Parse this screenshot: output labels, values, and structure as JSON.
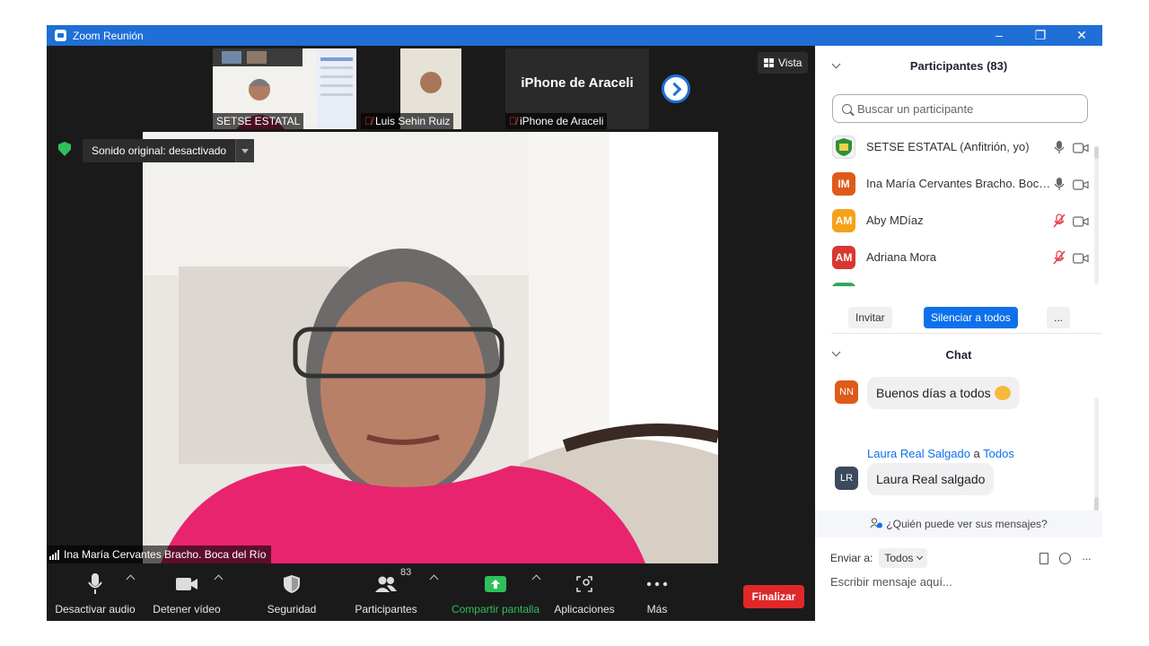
{
  "window": {
    "title": "Zoom Reunión",
    "minimize": "–",
    "restore": "❐",
    "close": "✕"
  },
  "strip": {
    "thumbs": [
      {
        "name": "SETSE ESTATAL",
        "muted": false
      },
      {
        "name": "Luis Sehin Ruiz",
        "muted": true
      },
      {
        "name": "iPhone de Araceli",
        "muted": true,
        "big_name": "iPhone de Araceli"
      }
    ],
    "view_label": "Vista"
  },
  "main_video": {
    "original_sound_label": "Sonido original: desactivado",
    "speaker_name": "Ina María Cervantes Bracho. Boca del Río"
  },
  "toolbar": {
    "audio": "Desactivar audio",
    "video": "Detener vídeo",
    "security": "Seguridad",
    "participants": "Participantes",
    "participants_count": "83",
    "share": "Compartir pantalla",
    "apps": "Aplicaciones",
    "more": "Más",
    "end": "Finalizar"
  },
  "participants_panel": {
    "title": "Participantes (83)",
    "search_placeholder": "Buscar un participante",
    "list": [
      {
        "initials": "",
        "name": "SETSE ESTATAL (Anfitrión, yo)",
        "color": "#f4f4f4",
        "mic_muted": false
      },
      {
        "initials": "IM",
        "name": "Ina María Cervantes Bracho. Boca del Río",
        "color": "#e05a1a",
        "mic_muted": false
      },
      {
        "initials": "AM",
        "name": "Aby MDíaz",
        "color": "#f5a21b",
        "mic_muted": true
      },
      {
        "initials": "AM",
        "name": "Adriana Mora",
        "color": "#d9372f",
        "mic_muted": true
      }
    ],
    "invite": "Invitar",
    "mute_all": "Silenciar a todos",
    "more": "..."
  },
  "chat": {
    "title": "Chat",
    "messages": [
      {
        "initials": "NN",
        "color": "#e05a1a",
        "text": "Buenos días a todos"
      },
      {
        "initials": "LR",
        "color": "#3c4a5e",
        "sender": "Laura Real Salgado",
        "to_word": "a",
        "to": "Todos",
        "text": "Laura Real salgado"
      }
    ],
    "who_can_see": "¿Quién puede ver sus mensajes?",
    "send_to_label": "Enviar a:",
    "send_to_value": "Todos",
    "input_placeholder": "Escribir mensaje aquí..."
  },
  "colors": {
    "accent": "#0e71eb",
    "title_bar": "#1f6fd6",
    "end": "#e02828",
    "share": "#2fbf5b"
  }
}
